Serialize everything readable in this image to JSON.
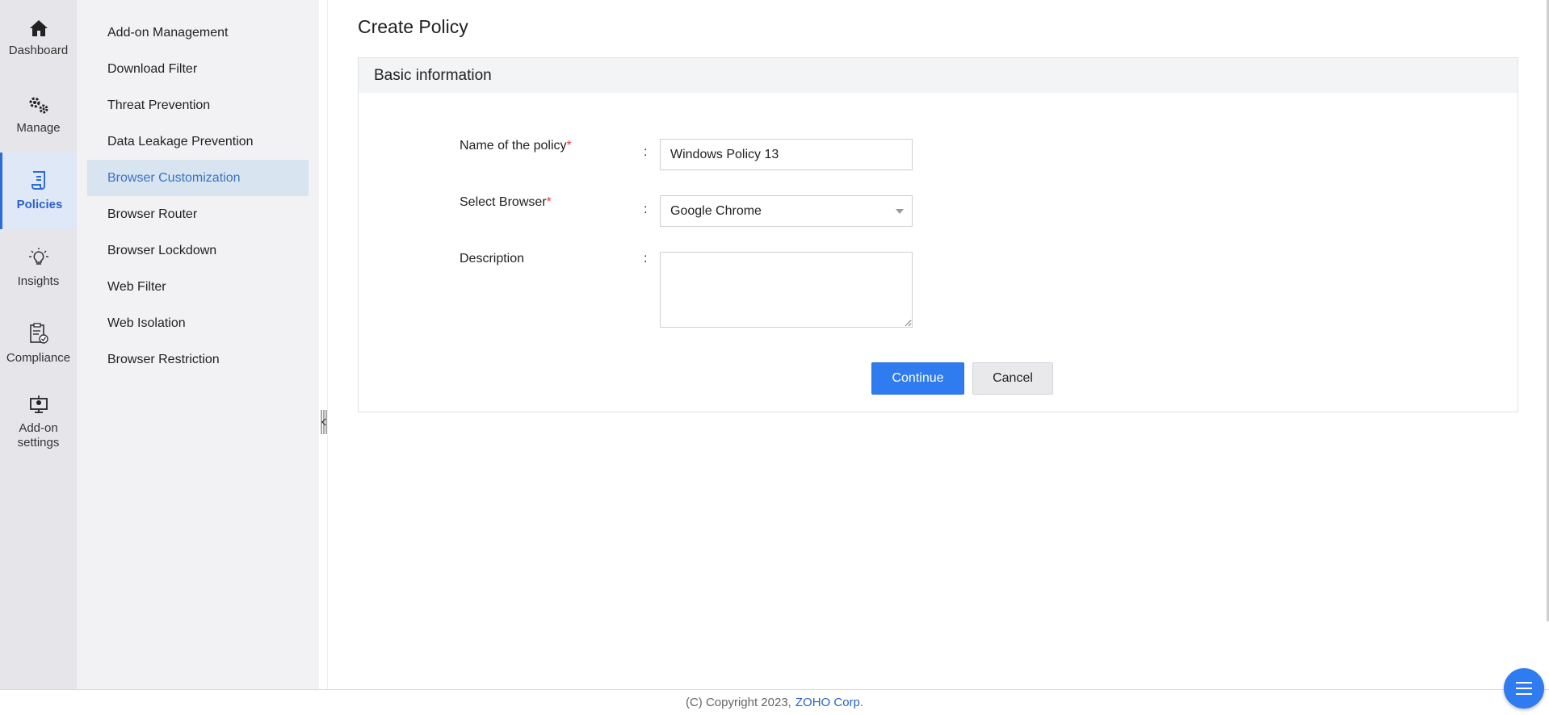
{
  "rail": {
    "items": [
      {
        "label": "Dashboard",
        "icon": "home-icon"
      },
      {
        "label": "Manage",
        "icon": "gears-icon"
      },
      {
        "label": "Policies",
        "icon": "policy-scroll-icon",
        "active": true
      },
      {
        "label": "Insights",
        "icon": "lightbulb-icon"
      },
      {
        "label": "Compliance",
        "icon": "clipboard-check-icon"
      },
      {
        "label": "Add-on settings",
        "icon": "monitor-settings-icon"
      }
    ]
  },
  "submenu": {
    "items": [
      "Add-on Management",
      "Download Filter",
      "Threat Prevention",
      "Data Leakage Prevention",
      "Browser Customization",
      "Browser Router",
      "Browser Lockdown",
      "Web Filter",
      "Web Isolation",
      "Browser Restriction"
    ],
    "active": "Browser Customization"
  },
  "page": {
    "title": "Create Policy",
    "section_title": "Basic information"
  },
  "form": {
    "name_label": "Name of the policy",
    "name_value": "Windows Policy 13",
    "browser_label": "Select Browser",
    "browser_value": "Google Chrome",
    "description_label": "Description",
    "description_value": "",
    "required_mark": "*",
    "colon": ":"
  },
  "buttons": {
    "continue": "Continue",
    "cancel": "Cancel"
  },
  "footer": {
    "copyright": "(C) Copyright 2023,",
    "company": "ZOHO Corp."
  },
  "colors": {
    "accent": "#2f7bf0",
    "active_text": "#2a62c9",
    "required": "#e03b3b"
  }
}
